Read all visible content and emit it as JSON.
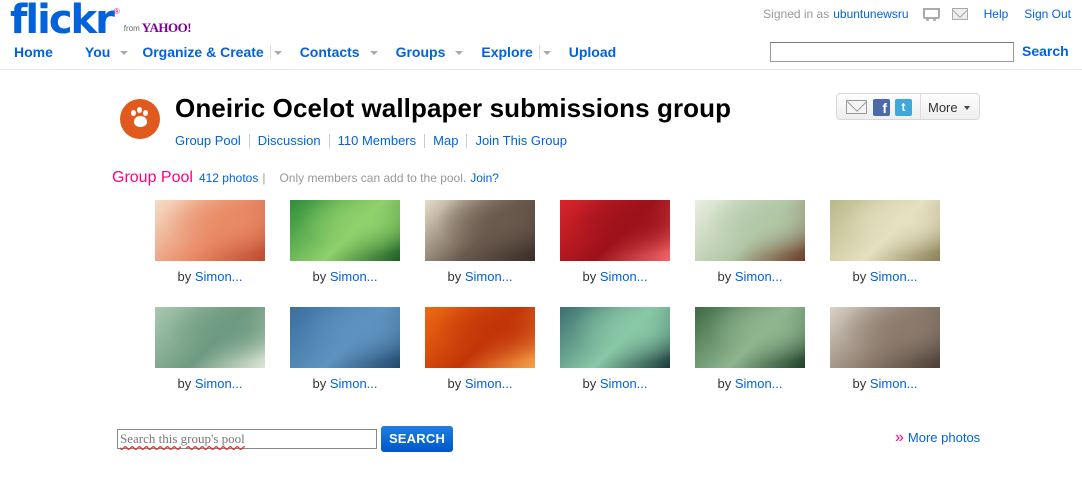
{
  "brand": {
    "logo_text": "flickr",
    "registered": "®",
    "from": "from",
    "yahoo": "YAHOO!",
    "colors": {
      "blue": "#0063dc",
      "pink": "#ff0084",
      "yahoo_purple": "#7b0099"
    }
  },
  "userbar": {
    "signed_in_label": "Signed in as",
    "username": "ubuntunewsru",
    "icons": [
      "cart-icon",
      "mail-icon"
    ],
    "help": "Help",
    "sign_out": "Sign Out"
  },
  "nav": {
    "items": [
      {
        "label": "Home",
        "has_menu": false
      },
      {
        "label": "You",
        "has_menu": true
      },
      {
        "label": "Organize & Create",
        "has_menu": true
      },
      {
        "label": "Contacts",
        "has_menu": true
      },
      {
        "label": "Groups",
        "has_menu": true
      },
      {
        "label": "Explore",
        "has_menu": true
      },
      {
        "label": "Upload",
        "has_menu": false
      }
    ],
    "search_value": "",
    "search_button": "Search"
  },
  "group": {
    "title": "Oneiric Ocelot wallpaper submissions group",
    "icon": "paw-icon",
    "links": [
      "Group Pool",
      "Discussion",
      "110 Members",
      "Map",
      "Join This Group"
    ],
    "share": {
      "icons": [
        "email-icon",
        "facebook-icon",
        "twitter-icon"
      ],
      "more": "More"
    }
  },
  "pool": {
    "title": "Group Pool",
    "count": "412 photos",
    "separator": "|",
    "note": "Only members can add to the pool.",
    "join": "Join?",
    "by_label": "by",
    "photos": [
      {
        "by": "Simon...",
        "colors": [
          "#f6ddc7",
          "#e98a66",
          "#c0492f"
        ]
      },
      {
        "by": "Simon...",
        "colors": [
          "#2f8d3b",
          "#8fd16b",
          "#1b5e24"
        ]
      },
      {
        "by": "Simon...",
        "colors": [
          "#e8ddc9",
          "#6a5a4e",
          "#3a2c26"
        ]
      },
      {
        "by": "Simon...",
        "colors": [
          "#d9242c",
          "#9d111a",
          "#f2666a"
        ]
      },
      {
        "by": "Simon...",
        "colors": [
          "#e8eee0",
          "#b1c7a6",
          "#6b3b28"
        ]
      },
      {
        "by": "Simon...",
        "colors": [
          "#b9b888",
          "#e4e0c0",
          "#8a7f55"
        ]
      },
      {
        "by": "Simon...",
        "colors": [
          "#a8c8b0",
          "#6d9a80",
          "#dfe6d6"
        ]
      },
      {
        "by": "Simon...",
        "colors": [
          "#3a6f9e",
          "#5f93bf",
          "#22496d"
        ]
      },
      {
        "by": "Simon...",
        "colors": [
          "#ec6a12",
          "#c33508",
          "#f6a24a"
        ]
      },
      {
        "by": "Simon...",
        "colors": [
          "#3c6f6f",
          "#89c8a6",
          "#1b3b3b"
        ]
      },
      {
        "by": "Simon...",
        "colors": [
          "#3f6a45",
          "#8fb58e",
          "#1f3f28"
        ]
      },
      {
        "by": "Simon...",
        "colors": [
          "#d9d1c6",
          "#8c7b6d",
          "#4c3f37"
        ]
      }
    ],
    "search_placeholder": "Search this group's pool",
    "search_button": "SEARCH",
    "more_photos_chevron": "»",
    "more_photos": "More photos"
  }
}
